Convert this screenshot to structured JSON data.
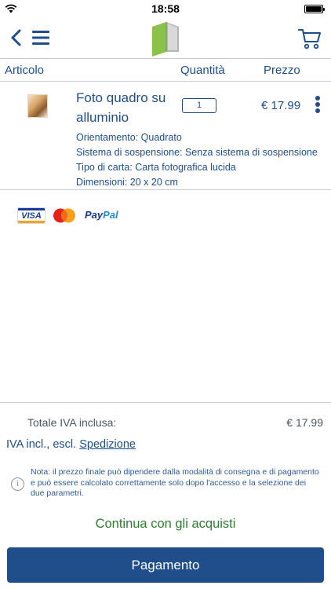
{
  "status_bar": {
    "time": "18:58"
  },
  "nav": {
    "back_icon": "chevron-left-icon",
    "menu_icon": "hamburger-menu-icon",
    "logo_icon": "open-book-logo",
    "cart_icon": "shopping-cart-icon"
  },
  "table_header": {
    "article": "Articolo",
    "quantity": "Quantità",
    "price": "Prezzo"
  },
  "cart_item": {
    "name": "Foto quadro su alluminio",
    "quantity": "1",
    "price": "€ 17.99",
    "attributes": [
      "Orientamento: Quadrato",
      "Sistema di sospensione: Senza sistema di sospensione",
      "Tipo di carta: Carta fotografica lucida",
      "Dimensioni: 20 x 20 cm"
    ]
  },
  "payment_methods": {
    "visa": "VISA",
    "paypal_pay": "Pay",
    "paypal_pal": "Pal"
  },
  "totals": {
    "label": "Totale IVA inclusa:",
    "value": "€ 17.99",
    "vat_text": "IVA incl., escl.",
    "shipping_link": "Spedizione"
  },
  "note": "Nota: il prezzo finale può dipendere dalla modalità di consegna e di pagamento e può essere calcolato correttamente solo dopo l'accesso e la selezione dei due parametri.",
  "actions": {
    "continue_label": "Continua con gli acquisti",
    "pay_label": "Pagamento"
  },
  "colors": {
    "brand_blue": "#1f4e8a",
    "continue_green": "#2e7d32",
    "logo_green": "#8bc34a"
  }
}
